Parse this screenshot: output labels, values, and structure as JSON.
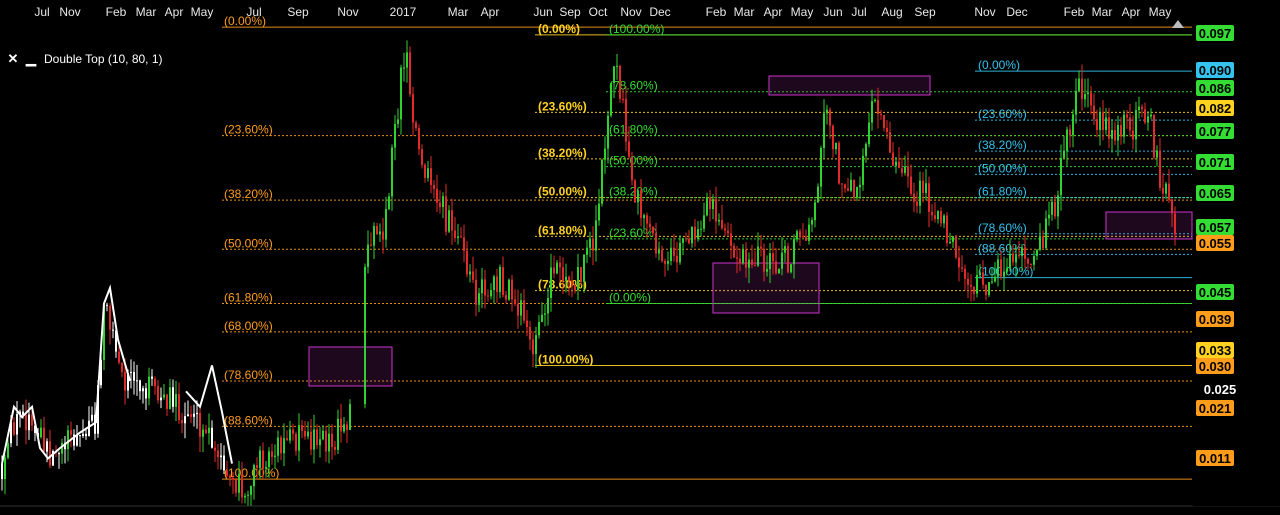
{
  "study": {
    "name": "Double Top (10, 80, 1)",
    "close_icon": "close-icon",
    "minimize_icon": "minimize-icon"
  },
  "colors": {
    "background": "#000000",
    "up": "#2fd32f",
    "down": "#e22a2a",
    "neutral": "#ffffff",
    "orange": "#ff9d1a",
    "yellow": "#ffd21f",
    "green": "#33dd33",
    "cyan": "#33c3ee",
    "magenta": "#cc33cc"
  },
  "chart_data": {
    "type": "candlestick",
    "ylim": [
      0.0085,
      0.0995
    ],
    "time_axis": [
      "Jul",
      "Nov",
      "Feb",
      "Mar",
      "Apr",
      "May",
      "Jul",
      "Sep",
      "Nov",
      "2017",
      "Mar",
      "Apr",
      "Jun",
      "Sep",
      "Oct",
      "Nov",
      "Dec",
      "Feb",
      "Mar",
      "Apr",
      "May",
      "Jun",
      "Jul",
      "Aug",
      "Sep",
      "Nov",
      "Dec",
      "Feb",
      "Mar",
      "Apr",
      "May"
    ],
    "price_scale": [
      {
        "value": "0.097",
        "color": "#33dd33"
      },
      {
        "value": "0.090",
        "color": "#33c3ee"
      },
      {
        "value": "0.086",
        "color": "#33dd33"
      },
      {
        "value": "0.082",
        "color": "#ffd21f"
      },
      {
        "value": "0.077",
        "color": "#33dd33"
      },
      {
        "value": "0.071",
        "color": "#33dd33"
      },
      {
        "value": "0.065",
        "color": "#33dd33"
      },
      {
        "value": "0.057",
        "color": "#33dd33"
      },
      {
        "value": "0.055",
        "color": "#ff9d1a"
      },
      {
        "value": "0.045",
        "color": "#33dd33"
      },
      {
        "value": "0.039",
        "color": "#ff9d1a"
      },
      {
        "value": "0.033",
        "color": "#ffd21f"
      },
      {
        "value": "0.030",
        "color": "#ff9d1a"
      },
      {
        "value": "0.025",
        "color": "none"
      },
      {
        "value": "0.021",
        "color": "#ff9d1a"
      },
      {
        "value": "0.011",
        "color": "#ff9d1a"
      }
    ],
    "fib_sets": [
      {
        "color": "#ff9d1a",
        "x_start": "Jul",
        "levels": [
          {
            "label": "(0.00%)",
            "value": 0.0985
          },
          {
            "label": "(23.60%)",
            "value": 0.0775
          },
          {
            "label": "(38.20%)",
            "value": 0.065
          },
          {
            "label": "(50.00%)",
            "value": 0.0555
          },
          {
            "label": "(61.80%)",
            "value": 0.045
          },
          {
            "label": "(68.00%)",
            "value": 0.0395
          },
          {
            "label": "(78.60%)",
            "value": 0.03
          },
          {
            "label": "(88.60%)",
            "value": 0.0212
          },
          {
            "label": "(100.00%)",
            "value": 0.011
          }
        ]
      },
      {
        "color": "#ffd21f",
        "x_start": "Jun",
        "levels": [
          {
            "label": "(0.00%)",
            "value": 0.097
          },
          {
            "label": "(23.60%)",
            "value": 0.082
          },
          {
            "label": "(38.20%)",
            "value": 0.073
          },
          {
            "label": "(50.00%)",
            "value": 0.0655
          },
          {
            "label": "(61.80%)",
            "value": 0.058
          },
          {
            "label": "(78.60%)",
            "value": 0.0475
          },
          {
            "label": "(100.00%)",
            "value": 0.033
          }
        ]
      },
      {
        "color": "#33dd33",
        "x_start": "Nov",
        "levels": [
          {
            "label": "(100.00%)",
            "value": 0.097
          },
          {
            "label": "(78.60%)",
            "value": 0.086
          },
          {
            "label": "(61.80%)",
            "value": 0.0775
          },
          {
            "label": "(50.00%)",
            "value": 0.0715
          },
          {
            "label": "(38.20%)",
            "value": 0.0655
          },
          {
            "label": "(23.60%)",
            "value": 0.0575
          },
          {
            "label": "(0.00%)",
            "value": 0.045
          }
        ]
      },
      {
        "color": "#33c3ee",
        "x_start": "Nov",
        "levels": [
          {
            "label": "(0.00%)",
            "value": 0.09
          },
          {
            "label": "(23.60%)",
            "value": 0.0805
          },
          {
            "label": "(38.20%)",
            "value": 0.0745
          },
          {
            "label": "(50.00%)",
            "value": 0.07
          },
          {
            "label": "(61.80%)",
            "value": 0.0655
          },
          {
            "label": "(78.60%)",
            "value": 0.0585
          },
          {
            "label": "(88.60%)",
            "value": 0.0545
          },
          {
            "label": "(100.00%)",
            "value": 0.05
          }
        ]
      }
    ]
  }
}
